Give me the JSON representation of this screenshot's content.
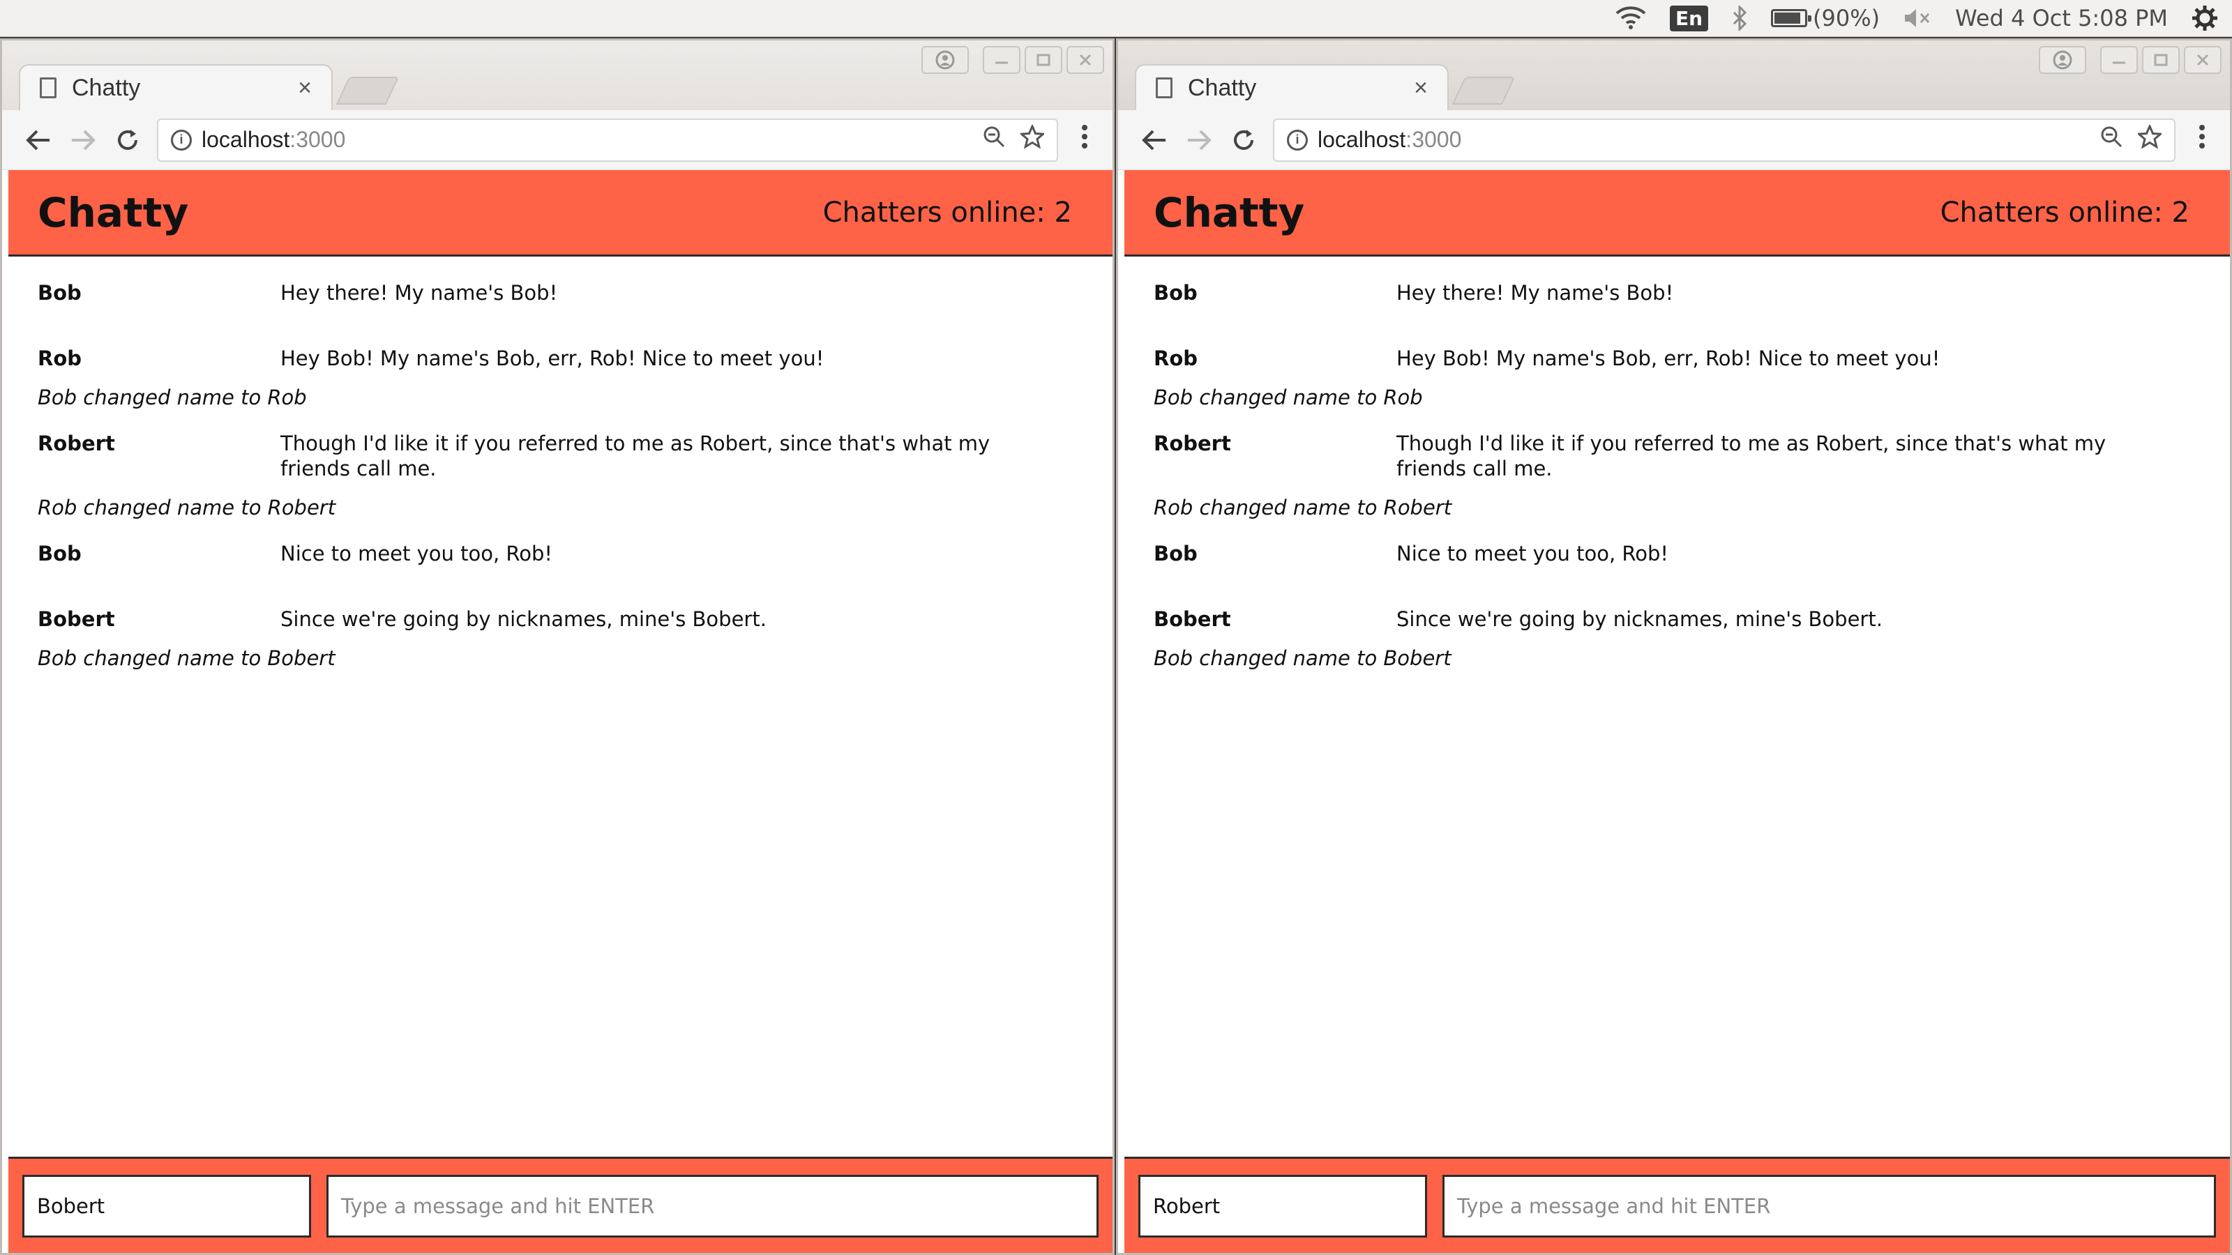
{
  "system_bar": {
    "keyboard_layout": "En",
    "battery_text": "(90%)",
    "battery_level": 0.9,
    "clock": "Wed  4 Oct  5:08 PM",
    "icons": [
      "wifi-icon",
      "bluetooth-icon",
      "battery-icon",
      "volume-muted-icon",
      "settings-gear-icon"
    ]
  },
  "windows": [
    {
      "tab_title": "Chatty",
      "tab_close": "×",
      "url_host": "localhost",
      "url_port": ":3000",
      "app": {
        "brand": "Chatty",
        "online_text": "Chatters online: 2",
        "messages": [
          {
            "user": "Bob",
            "text": "Hey there! My name's Bob!"
          },
          {
            "user": "Rob",
            "text": "Hey Bob! My name's Bob, err, Rob! Nice to meet you!"
          },
          {
            "system": "Bob changed name to Rob"
          },
          {
            "user": "Robert",
            "text": "Though I'd like it if you referred to me as Robert, since that's what my friends call me."
          },
          {
            "system": "Rob changed name to Robert"
          },
          {
            "user": "Bob",
            "text": "Nice to meet you too, Rob!"
          },
          {
            "user": "Bobert",
            "text": "Since we're going by nicknames, mine's Bobert."
          },
          {
            "system": "Bob changed name to Bobert"
          }
        ],
        "username_value": "Bobert",
        "message_placeholder": "Type a message and hit ENTER"
      }
    },
    {
      "tab_title": "Chatty",
      "tab_close": "×",
      "url_host": "localhost",
      "url_port": ":3000",
      "app": {
        "brand": "Chatty",
        "online_text": "Chatters online: 2",
        "messages": [
          {
            "user": "Bob",
            "text": "Hey there! My name's Bob!"
          },
          {
            "user": "Rob",
            "text": "Hey Bob! My name's Bob, err, Rob! Nice to meet you!"
          },
          {
            "system": "Bob changed name to Rob"
          },
          {
            "user": "Robert",
            "text": "Though I'd like it if you referred to me as Robert, since that's what my friends call me."
          },
          {
            "system": "Rob changed name to Robert"
          },
          {
            "user": "Bob",
            "text": "Nice to meet you too, Rob!"
          },
          {
            "user": "Bobert",
            "text": "Since we're going by nicknames, mine's Bobert."
          },
          {
            "system": "Bob changed name to Bobert"
          }
        ],
        "username_value": "Robert",
        "message_placeholder": "Type a message and hit ENTER"
      }
    }
  ],
  "colors": {
    "brand_accent": "#ff6347",
    "header_text": "#111111"
  }
}
